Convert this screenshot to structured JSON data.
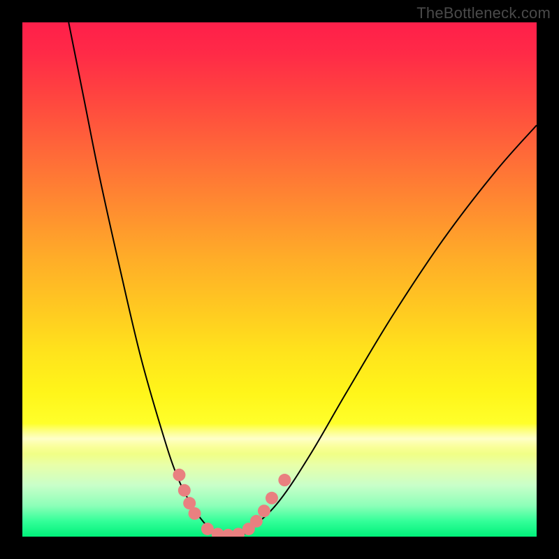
{
  "watermark": "TheBottleneck.com",
  "chart_data": {
    "type": "line",
    "title": "",
    "xlabel": "",
    "ylabel": "",
    "xlim": [
      0,
      100
    ],
    "ylim": [
      0,
      100
    ],
    "background_gradient": {
      "orientation": "vertical",
      "stops": [
        {
          "pos": 0,
          "color": "#ff1f4a"
        },
        {
          "pos": 26,
          "color": "#ff6b38"
        },
        {
          "pos": 56,
          "color": "#ffca21"
        },
        {
          "pos": 78,
          "color": "#ffff2a"
        },
        {
          "pos": 90,
          "color": "#c9ffc9"
        },
        {
          "pos": 100,
          "color": "#00f07a"
        }
      ]
    },
    "series": [
      {
        "name": "bottleneck-curve",
        "stroke": "#000000",
        "stroke_width": 2,
        "points": [
          {
            "x": 9,
            "y": 100
          },
          {
            "x": 12,
            "y": 85
          },
          {
            "x": 15,
            "y": 70
          },
          {
            "x": 19,
            "y": 52
          },
          {
            "x": 23,
            "y": 35
          },
          {
            "x": 27,
            "y": 21
          },
          {
            "x": 30,
            "y": 12
          },
          {
            "x": 33,
            "y": 6
          },
          {
            "x": 36,
            "y": 2
          },
          {
            "x": 39,
            "y": 0
          },
          {
            "x": 42,
            "y": 0
          },
          {
            "x": 45,
            "y": 2
          },
          {
            "x": 50,
            "y": 7
          },
          {
            "x": 56,
            "y": 16
          },
          {
            "x": 63,
            "y": 28
          },
          {
            "x": 72,
            "y": 43
          },
          {
            "x": 82,
            "y": 58
          },
          {
            "x": 92,
            "y": 71
          },
          {
            "x": 100,
            "y": 80
          }
        ]
      },
      {
        "name": "highlight-dots",
        "type": "scatter",
        "marker_color": "#e98080",
        "marker_radius": 9,
        "points": [
          {
            "x": 30.5,
            "y": 12
          },
          {
            "x": 31.5,
            "y": 9
          },
          {
            "x": 32.5,
            "y": 6.5
          },
          {
            "x": 33.5,
            "y": 4.5
          },
          {
            "x": 36,
            "y": 1.5
          },
          {
            "x": 38,
            "y": 0.5
          },
          {
            "x": 40,
            "y": 0.3
          },
          {
            "x": 42,
            "y": 0.5
          },
          {
            "x": 44,
            "y": 1.5
          },
          {
            "x": 45.5,
            "y": 3
          },
          {
            "x": 47,
            "y": 5
          },
          {
            "x": 48.5,
            "y": 7.5
          },
          {
            "x": 51,
            "y": 11
          }
        ]
      }
    ]
  }
}
